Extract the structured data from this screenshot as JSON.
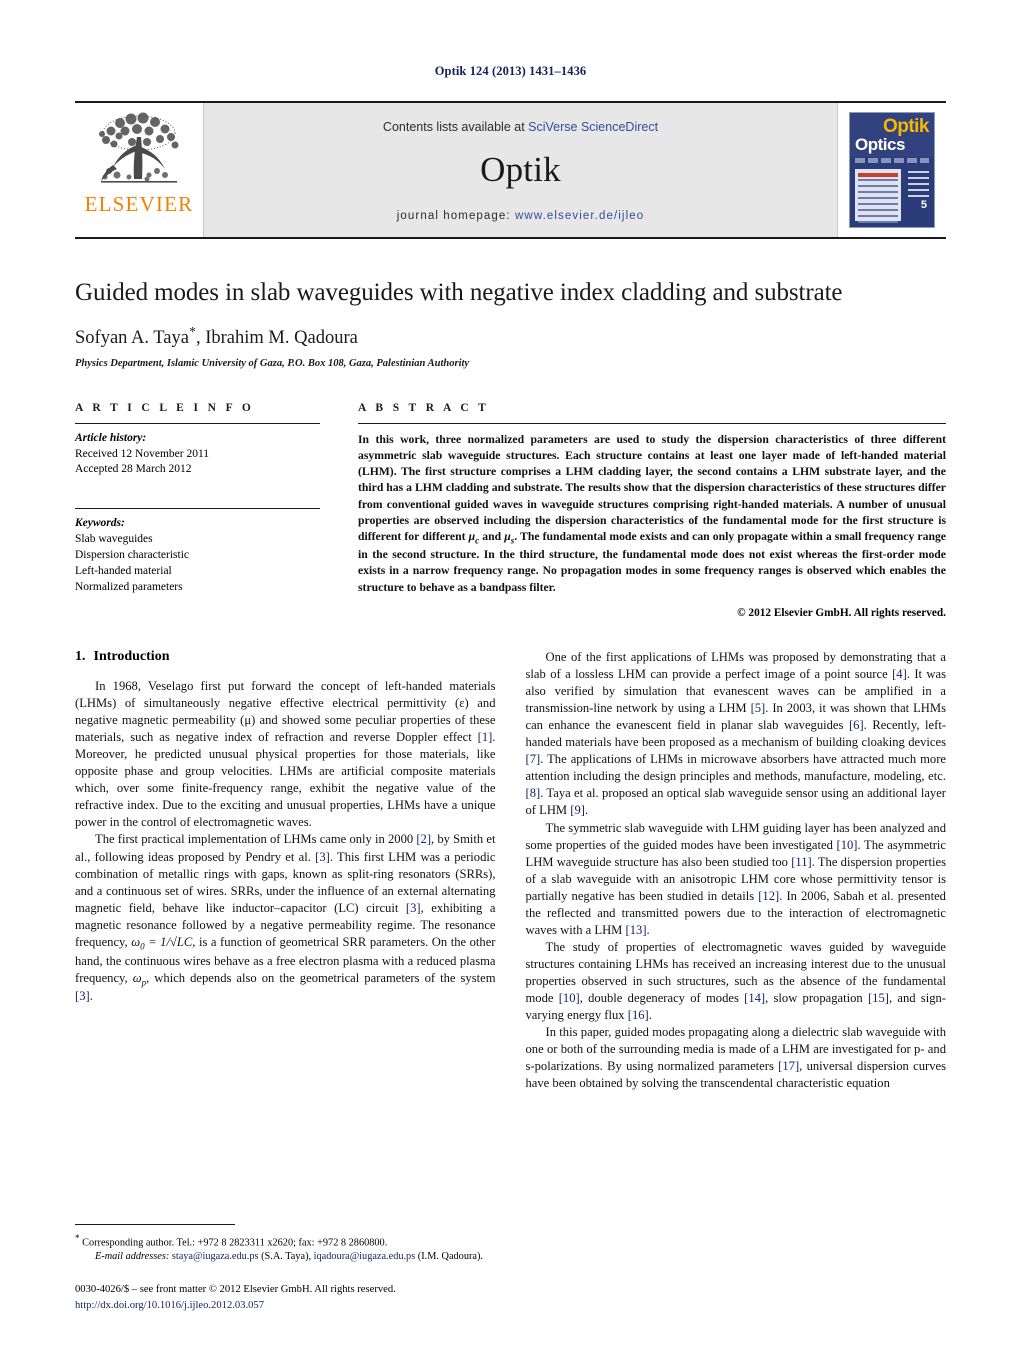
{
  "running_head": "Optik 124 (2013) 1431–1436",
  "masthead": {
    "publisher": "ELSEVIER",
    "contents_prefix": "Contents lists available at ",
    "contents_link": "SciVerse ScienceDirect",
    "journal_name": "Optik",
    "homepage_prefix": "journal homepage: ",
    "homepage_url": "www.elsevier.de/ijleo",
    "cover": {
      "title_top": "Optik",
      "title_bottom": "Optics",
      "issue_number": "5"
    }
  },
  "article": {
    "title": "Guided modes in slab waveguides with negative index cladding and substrate",
    "authors": "Sofyan A. Taya",
    "authors_rest": ", Ibrahim M. Qadoura",
    "corresponding_marker": "*",
    "affiliation": "Physics Department, Islamic University of Gaza, P.O. Box 108, Gaza, Palestinian Authority"
  },
  "article_info": {
    "heading": "A R T I C L E  I N F O",
    "history_label": "Article history:",
    "received": "Received 12 November 2011",
    "accepted": "Accepted 28 March 2012",
    "keywords_label": "Keywords:",
    "keywords": [
      "Slab waveguides",
      "Dispersion characteristic",
      "Left-handed material",
      "Normalized parameters"
    ]
  },
  "abstract": {
    "heading": "A B S T R A C T",
    "part1": "In this work, three normalized parameters are used to study the dispersion characteristics of three different asymmetric slab waveguide structures. Each structure contains at least one layer made of left-handed material (LHM). The first structure comprises a LHM cladding layer, the second contains a LHM substrate layer, and the third has a LHM cladding and substrate. The results show that the dispersion characteristics of these structures differ from conventional guided waves in waveguide structures comprising right-handed materials. A number of unusual properties are observed including the dispersion characteristics of the fundamental mode for the first structure is different for different ",
    "mu_c": "μ",
    "mu_c_sub": "c",
    "mid": " and ",
    "mu_s": "μ",
    "mu_s_sub": "s",
    "part2": ". The fundamental mode exists and can only propagate within a small frequency range in the second structure. In the third structure, the fundamental mode does not exist whereas the first-order mode exists in a narrow frequency range. No propagation modes in some frequency ranges is observed which enables the structure to behave as a bandpass filter.",
    "copyright": "© 2012 Elsevier GmbH. All rights reserved."
  },
  "section1": {
    "number": "1.",
    "title": "Introduction",
    "left_paragraphs": [
      {
        "t1": "In 1968, Veselago first put forward the concept of left-handed materials (LHMs) of simultaneously negative effective electrical permittivity (ε) and negative magnetic permeability (μ) and showed some peculiar properties of these materials, such as negative index of refraction and reverse Doppler effect ",
        "r1": "[1]",
        "t2": ". Moreover, he predicted unusual physical properties for those materials, like opposite phase and group velocities. LHMs are artificial composite materials which, over some finite-frequency range, exhibit the negative value of the refractive index. Due to the exciting and unusual properties, LHMs have a unique power in the control of electromagnetic waves."
      },
      {
        "t1": "The first practical implementation of LHMs came only in 2000 ",
        "r1": "[2]",
        "t2": ", by Smith et al., following ideas proposed by Pendry et al. ",
        "r2": "[3]",
        "t3": ". This first LHM was a periodic combination of metallic rings with gaps, known as split-ring resonators (SRRs), and a continuous set of wires. SRRs, under the influence of an external alternating magnetic field, behave like inductor–capacitor (LC) circuit ",
        "r3": "[3]",
        "t4": ", exhibiting a magnetic resonance followed by a negative permeability regime. The resonance frequency, ",
        "eq1": "ω",
        "eq1sub": "0",
        "eq2": " = 1/√LC",
        "t5": ", is a function of geometrical SRR parameters. On the other hand, the continuous wires behave as a free electron plasma with a reduced plasma frequency, ",
        "eq3": "ω",
        "eq3sub": "p",
        "t6": ", which depends also on the geometrical parameters of the system ",
        "r4": "[3]",
        "t7": "."
      }
    ],
    "right_paragraphs": [
      {
        "t1": "One of the first applications of LHMs was proposed by demonstrating that a slab of a lossless LHM can provide a perfect image of a point source ",
        "r1": "[4]",
        "t2": ". It was also verified by simulation that evanescent waves can be amplified in a transmission-line network by using a LHM ",
        "r2": "[5]",
        "t3": ". In 2003, it was shown that LHMs can enhance the evanescent field in planar slab waveguides ",
        "r3": "[6]",
        "t4": ". Recently, left-handed materials have been proposed as a mechanism of building cloaking devices ",
        "r4": "[7]",
        "t5": ". The applications of LHMs in microwave absorbers have attracted much more attention including the design principles and methods, manufacture, modeling, etc. ",
        "r5": "[8]",
        "t6": ". Taya et al. proposed an optical slab waveguide sensor using an additional layer of LHM ",
        "r6": "[9]",
        "t7": "."
      },
      {
        "t1": "The symmetric slab waveguide with LHM guiding layer has been analyzed and some properties of the guided modes have been investigated ",
        "r1": "[10]",
        "t2": ". The asymmetric LHM waveguide structure has also been studied too ",
        "r2": "[11]",
        "t3": ". The dispersion properties of a slab waveguide with an anisotropic LHM core whose permittivity tensor is partially negative has been studied in details ",
        "r3": "[12]",
        "t4": ". In 2006, Sabah et al. presented the reflected and transmitted powers due to the interaction of electromagnetic waves with a LHM ",
        "r4": "[13]",
        "t5": "."
      },
      {
        "t1": "The study of properties of electromagnetic waves guided by waveguide structures containing LHMs has received an increasing interest due to the unusual properties observed in such structures, such as the absence of the fundamental mode ",
        "r1": "[10]",
        "t2": ", double degeneracy of modes ",
        "r2": "[14]",
        "t3": ", slow propagation ",
        "r3": "[15]",
        "t4": ", and sign-varying energy flux ",
        "r4": "[16]",
        "t5": "."
      },
      {
        "t1": "In this paper, guided modes propagating along a dielectric slab waveguide with one or both of the surrounding media is made of a LHM are investigated for p- and s-polarizations. By using normalized parameters ",
        "r1": "[17]",
        "t2": ", universal dispersion curves have been obtained by solving the transcendental characteristic equation"
      }
    ]
  },
  "footnotes": {
    "corresponding": "Corresponding author. Tel.: +972 8 2823311 x2620; fax: +972 8 2860800.",
    "email_label": "E-mail addresses:",
    "email1": "staya@iugaza.edu.ps",
    "email1_name": " (S.A. Taya), ",
    "email2": "iqadoura@iugaza.edu.ps",
    "email2_name": " (I.M. Qadoura).",
    "frontmatter": "0030-4026/$ – see front matter © 2012 Elsevier GmbH. All rights reserved.",
    "doi": "http://dx.doi.org/10.1016/j.ijleo.2012.03.057"
  }
}
